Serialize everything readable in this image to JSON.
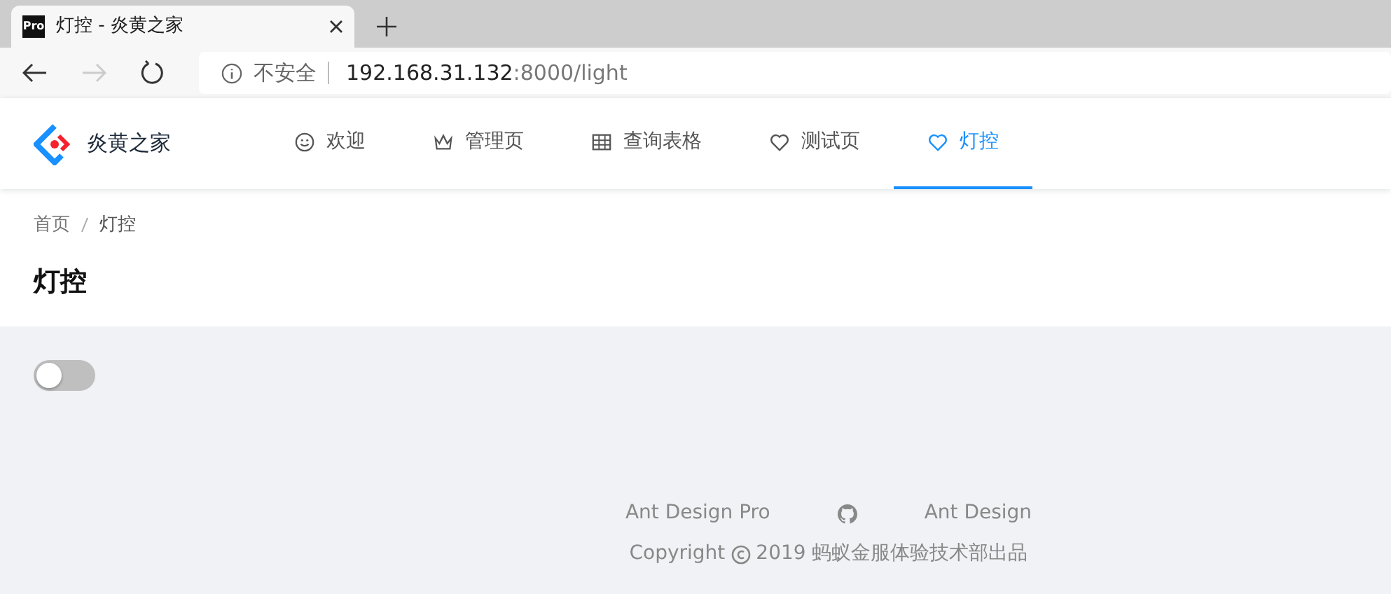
{
  "browser": {
    "tab": {
      "favicon_text": "Pro",
      "title": "灯控 - 炎黄之家"
    },
    "address": {
      "security": "不安全",
      "host": "192.168.31.132",
      "path": ":8000/light"
    }
  },
  "header": {
    "brand": "炎黄之家",
    "menu": [
      {
        "label": "欢迎",
        "kind": "smile",
        "selected": false
      },
      {
        "label": "管理页",
        "kind": "crown",
        "selected": false
      },
      {
        "label": "查询表格",
        "kind": "table",
        "selected": false
      },
      {
        "label": "测试页",
        "kind": "heart",
        "selected": false
      },
      {
        "label": "灯控",
        "kind": "heart",
        "selected": true
      }
    ]
  },
  "breadcrumb": [
    "首页",
    "灯控"
  ],
  "page_title": "灯控",
  "light_switch": {
    "checked": false
  },
  "footer": {
    "links": [
      {
        "kind": "text",
        "label": "Ant Design Pro"
      },
      {
        "kind": "github"
      },
      {
        "kind": "text",
        "label": "Ant Design"
      }
    ],
    "copyright_prefix": "Copyright",
    "copyright_text": "2019 蚂蚁金服体验技术部出品"
  }
}
